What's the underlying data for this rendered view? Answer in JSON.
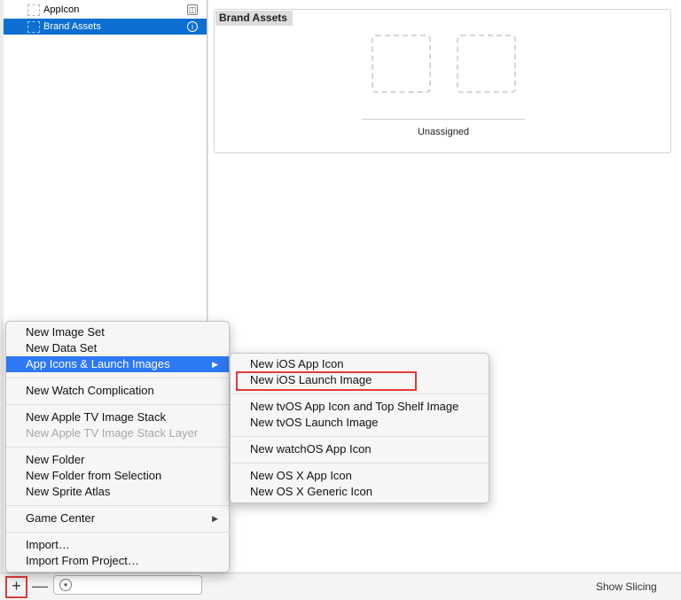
{
  "asset_list": [
    {
      "name": "AppIcon",
      "badge": "◫"
    },
    {
      "name": "Brand Assets",
      "badge": "i"
    }
  ],
  "detail": {
    "title": "Brand Assets",
    "slot_label": "Unassigned"
  },
  "bottom_bar": {
    "add_label": "+",
    "remove_label": "—",
    "show_slicing": "Show Slicing"
  },
  "menu": {
    "items": [
      "New Image Set",
      "New Data Set",
      "App Icons & Launch Images",
      "New Watch Complication",
      "New Apple TV Image Stack",
      "New Apple TV Image Stack Layer",
      "New Folder",
      "New Folder from Selection",
      "New Sprite Atlas",
      "Game Center",
      "Import…",
      "Import From Project…"
    ],
    "submenu_arrow": "▶"
  },
  "submenu": {
    "items": [
      "New iOS App Icon",
      "New iOS Launch Image",
      "New tvOS App Icon and Top Shelf Image",
      "New tvOS Launch Image",
      "New watchOS App Icon",
      "New OS X App Icon",
      "New OS X Generic Icon"
    ]
  },
  "colors": {
    "selection": "#0d6fd1",
    "menu_highlight": "#2d78f4",
    "annotation": "#e13a3a"
  }
}
